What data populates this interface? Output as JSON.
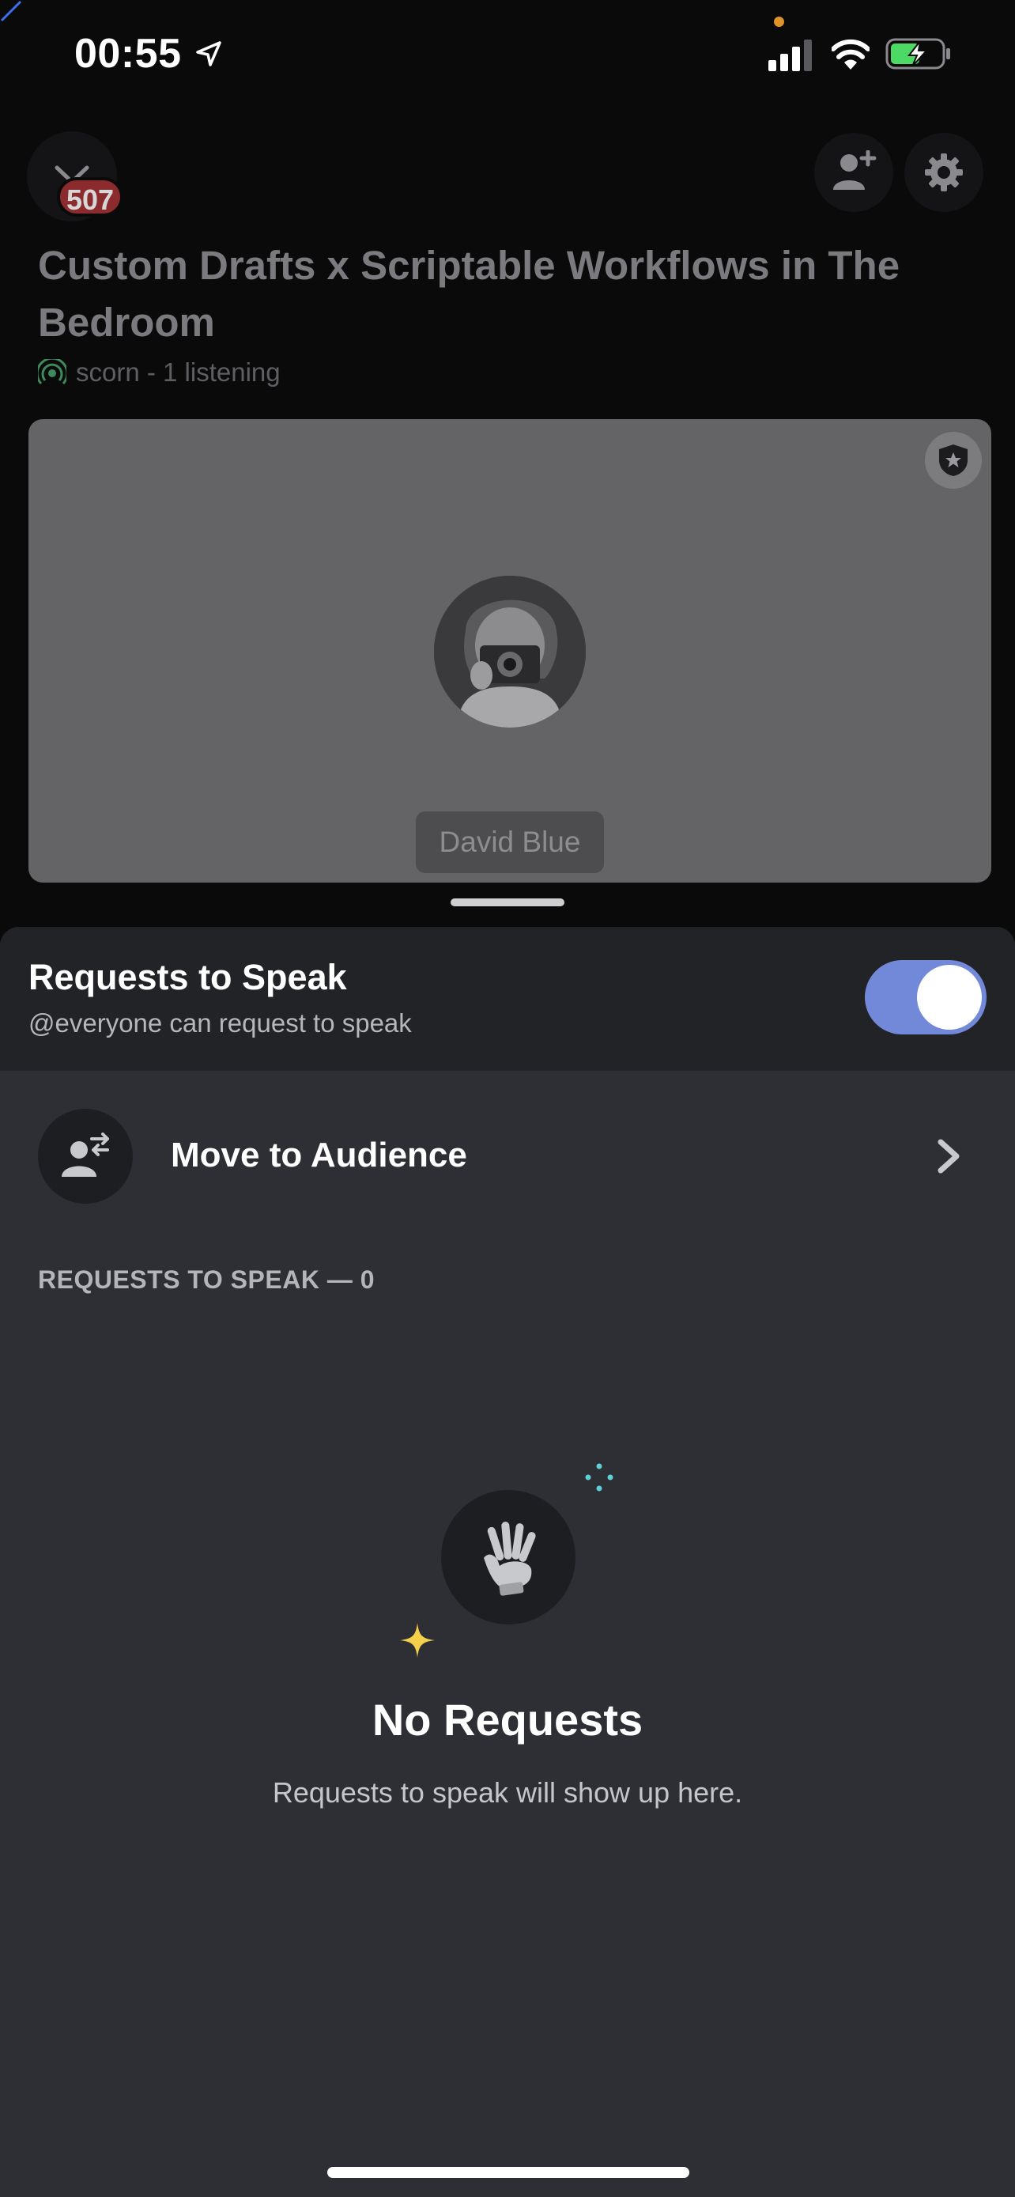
{
  "status_bar": {
    "time": "00:55",
    "icons": [
      "location-arrow-icon",
      "signal-icon",
      "wifi-icon",
      "battery-charging-icon"
    ]
  },
  "header": {
    "badge_count": "507",
    "title": "Custom Drafts x Scriptable Workflows in The Bedroom",
    "subtitle": "scorn - 1 listening"
  },
  "speaker_card": {
    "name": "David Blue"
  },
  "sheet": {
    "requests_title": "Requests to Speak",
    "requests_subtitle": "@everyone can request to speak",
    "toggle_on": true,
    "move_label": "Move to Audience",
    "section_label": "REQUESTS TO SPEAK — 0",
    "empty_title": "No Requests",
    "empty_subtitle": "Requests to speak will show up here."
  },
  "colors": {
    "accent": "#7289da",
    "badge": "#8b2b2d",
    "sheet_bg": "#2e2f34",
    "sparkle_teal": "#5fd0d6",
    "sparkle_yellow": "#f5d04a"
  }
}
